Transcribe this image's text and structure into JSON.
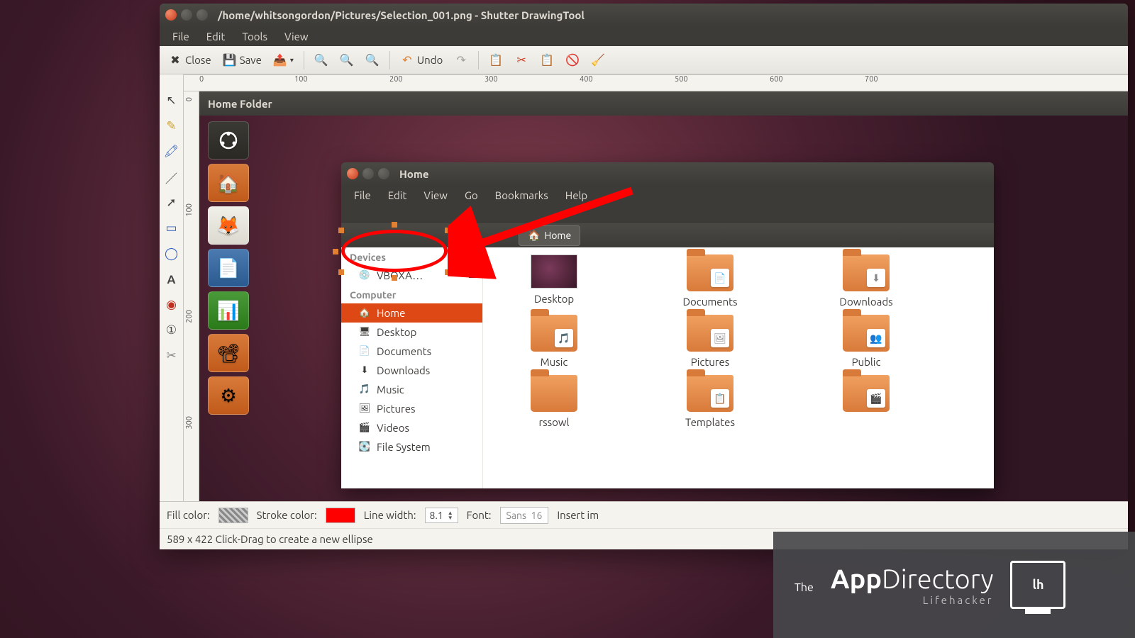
{
  "shutter": {
    "title": "/home/whitsongordon/Pictures/Selection_001.png - Shutter DrawingTool",
    "menu": {
      "file": "File",
      "edit": "Edit",
      "tools": "Tools",
      "view": "View"
    },
    "toolbar": {
      "close": "Close",
      "save": "Save",
      "undo": "Undo"
    },
    "ruler_ticks": [
      "0",
      "100",
      "200",
      "300",
      "400",
      "500",
      "600",
      "700"
    ],
    "ruler_v_ticks": [
      "0",
      "100",
      "200",
      "300"
    ],
    "options": {
      "fill_label": "Fill color:",
      "stroke_label": "Stroke color:",
      "line_width_label": "Line width:",
      "line_width_value": "8.1",
      "font_label": "Font:",
      "font_family": "Sans",
      "font_size": "16",
      "insert_label": "Insert im"
    },
    "status": "589 x 422 Click-Drag to create a new ellipse"
  },
  "screenshot": {
    "hf_title": "Home Folder",
    "nautilus": {
      "title": "Home",
      "menu": {
        "file": "File",
        "edit": "Edit",
        "view": "View",
        "go": "Go",
        "bookmarks": "Bookmarks",
        "help": "Help"
      },
      "path": "Home",
      "sidebar": {
        "devices_hdr": "Devices",
        "device_item": "VBOXA…",
        "computer_hdr": "Computer",
        "items": [
          {
            "label": "Home",
            "icon": "🏠",
            "sel": true
          },
          {
            "label": "Desktop",
            "icon": "🖥"
          },
          {
            "label": "Documents",
            "icon": "📄"
          },
          {
            "label": "Downloads",
            "icon": "⬇"
          },
          {
            "label": "Music",
            "icon": "🎵"
          },
          {
            "label": "Pictures",
            "icon": "🖼"
          },
          {
            "label": "Videos",
            "icon": "🎬"
          },
          {
            "label": "File System",
            "icon": "💽"
          }
        ]
      },
      "grid": [
        {
          "label": "Desktop",
          "type": "desktop"
        },
        {
          "label": "Documents",
          "badge": "📄"
        },
        {
          "label": "Downloads",
          "badge": "⬇"
        },
        {
          "label": "Music",
          "badge": "🎵"
        },
        {
          "label": "Pictures",
          "badge": "🖼"
        },
        {
          "label": "Public",
          "badge": "👥"
        },
        {
          "label": "rssowl",
          "badge": ""
        },
        {
          "label": "Templates",
          "badge": "📋"
        },
        {
          "label": "",
          "badge": "🎬"
        }
      ]
    }
  },
  "watermark": {
    "the": "The",
    "main_a": "App",
    "main_b": "Directory",
    "sub": "Lifehacker",
    "lh": "lh"
  }
}
